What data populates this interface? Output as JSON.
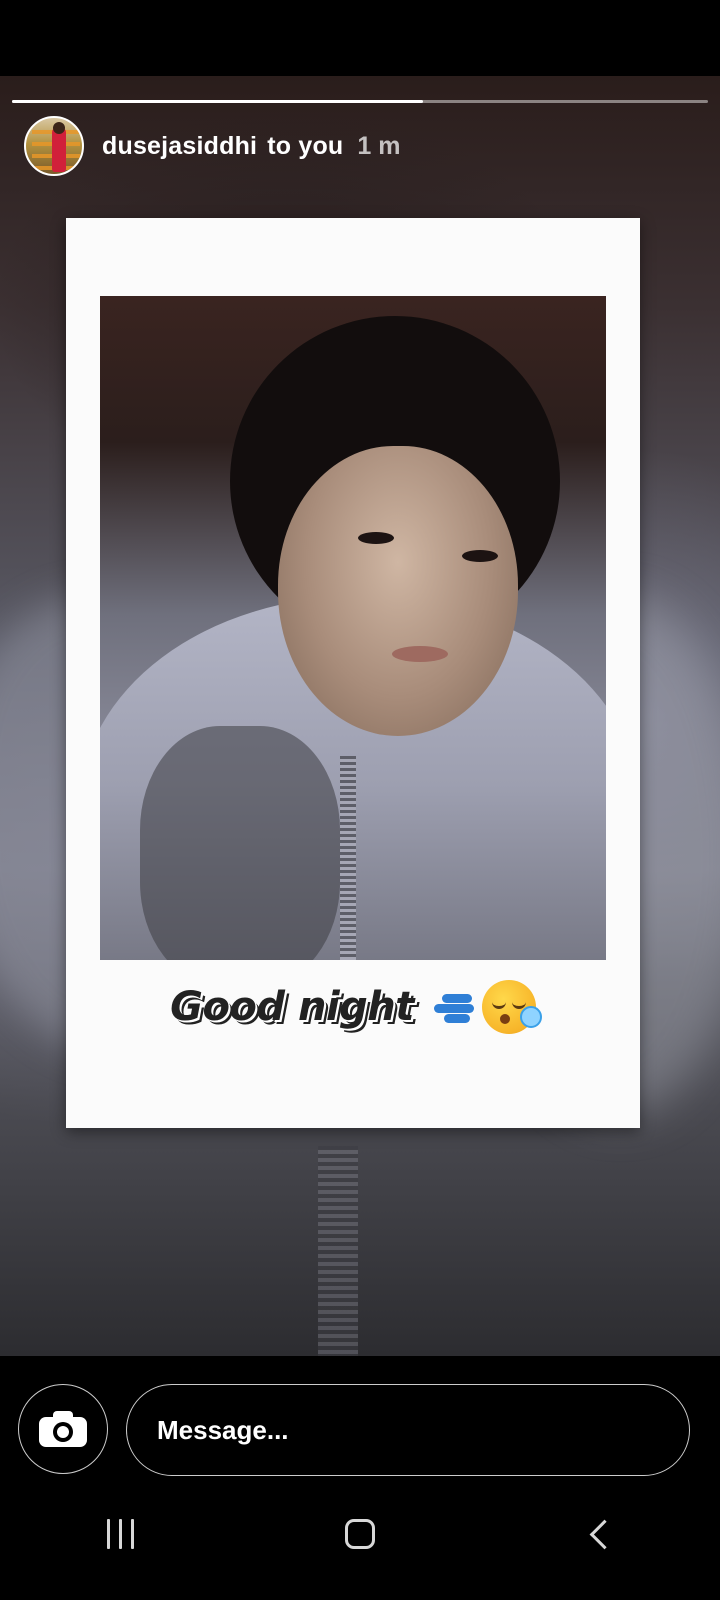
{
  "story": {
    "progress": 0.59,
    "username": "dusejasiddhi",
    "recipient_text": "to you",
    "time": "1 m",
    "caption": "Good night"
  },
  "reply_bar": {
    "message_placeholder": "Message..."
  },
  "icons": {
    "camera": "camera-icon",
    "caption_emojis": [
      "dash-icon",
      "sleepy-face-icon"
    ],
    "nav": [
      "recent-apps-icon",
      "home-icon",
      "back-icon"
    ]
  },
  "colors": {
    "background": "#000000",
    "text": "#ffffff",
    "emoji_blue": "#2f7fd6",
    "emoji_yellow": "#f7b52a"
  }
}
